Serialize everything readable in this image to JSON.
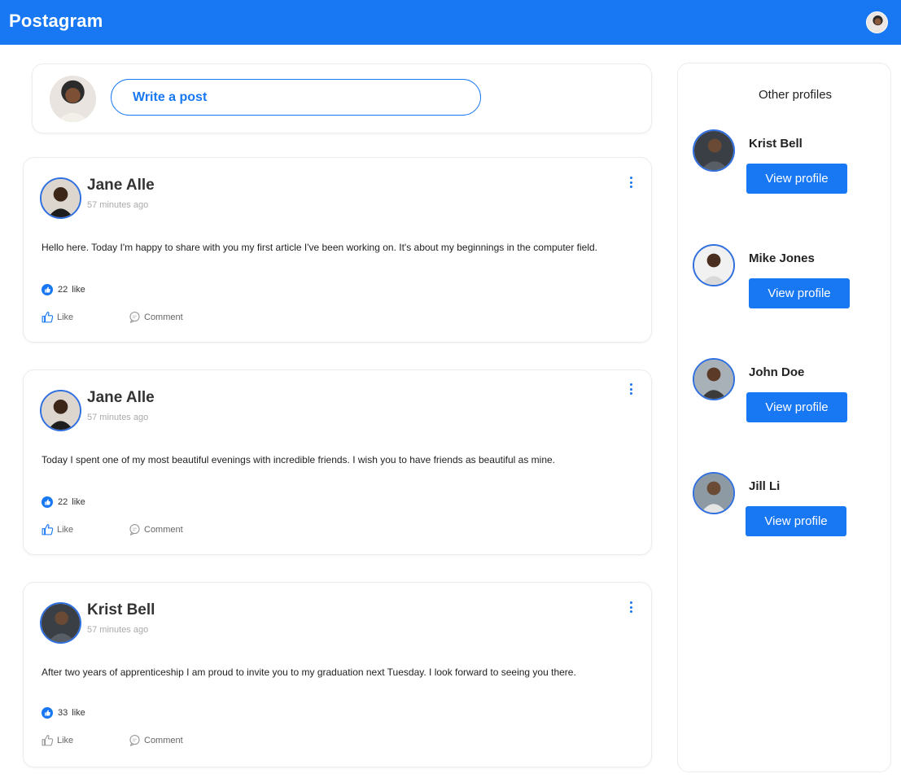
{
  "app": {
    "title": "Postagram"
  },
  "composer": {
    "button_label": "Write a post"
  },
  "posts": [
    {
      "author": "Jane Alle",
      "time": "57 minutes ago",
      "text": "Hello here. Today I'm happy to share with you my first article I've been working on. It's about my beginnings in the computer field.",
      "likes": "22",
      "likes_suffix": "like",
      "like_label": "Like",
      "comment_label": "Comment"
    },
    {
      "author": "Jane Alle",
      "time": "57 minutes ago",
      "text": "Today I spent one of my most beautiful evenings with incredible friends. I wish you to have friends as beautiful as mine.",
      "likes": "22",
      "likes_suffix": "like",
      "like_label": "Like",
      "comment_label": "Comment"
    },
    {
      "author": "Krist Bell",
      "time": "57 minutes ago",
      "text": "After two years of apprenticeship I am proud to invite you to my graduation next Tuesday. I look forward to seeing you there.",
      "likes": "33",
      "likes_suffix": "like",
      "like_label": "Like",
      "comment_label": "Comment"
    }
  ],
  "sidebar": {
    "title": "Other profiles",
    "profiles": [
      {
        "name": "Krist Bell",
        "button": "View profile"
      },
      {
        "name": "Mike Jones",
        "button": "View profile"
      },
      {
        "name": "John Doe",
        "button": "View profile"
      },
      {
        "name": "Jill Li",
        "button": "View profile"
      }
    ]
  },
  "colors": {
    "primary": "#1877f2",
    "ring": "#2f6fe0"
  }
}
